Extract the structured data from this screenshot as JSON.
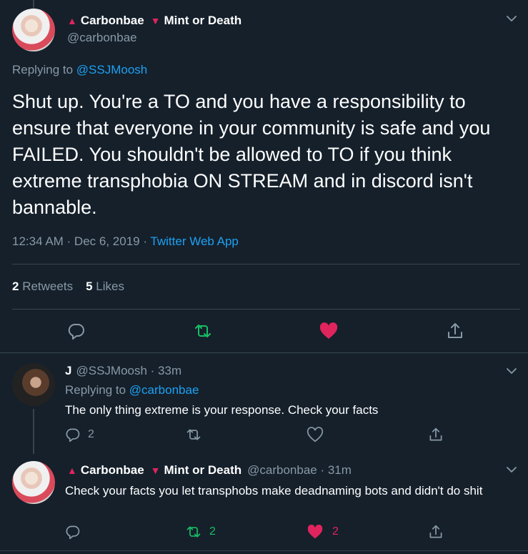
{
  "main_tweet": {
    "display_name": "Carbonbae",
    "display_name_suffix": "Mint or Death",
    "handle": "@carbonbae",
    "replying_to_label": "Replying to",
    "replying_to_handle": "@SSJMoosh",
    "text": "Shut up. You're a TO and you have a responsibility to ensure that everyone in your community is safe and you FAILED. You shouldn't be allowed to TO if you think extreme transphobia ON STREAM and in discord isn't bannable.",
    "time": "12:34 AM · Dec 6, 2019 ·",
    "source": "Twitter Web App",
    "retweets_count": "2",
    "retweets_label": "Retweets",
    "likes_count": "5",
    "likes_label": "Likes"
  },
  "replies": [
    {
      "display_name": "J",
      "handle_time": "@SSJMoosh · 33m",
      "replying_to_label": "Replying to",
      "replying_to_handle": "@carbonbae",
      "text": "The only thing extreme is your response. Check your facts",
      "reply_count": "2",
      "retweet_count": "",
      "like_count": ""
    },
    {
      "display_name": "Carbonbae",
      "display_name_suffix": "Mint or Death",
      "handle_time": "@carbonbae · 31m",
      "text": "Check your facts you let transphobs make deadnaming bots and didn't do shit",
      "reply_count": "",
      "retweet_count": "2",
      "like_count": "2"
    }
  ],
  "colors": {
    "background": "#15202b",
    "accent": "#1da1f2",
    "retweet_green": "#17bf63",
    "like_pink": "#e0245e",
    "muted": "#8899a6"
  },
  "icons": [
    "reply-icon",
    "retweet-icon",
    "like-icon",
    "share-icon",
    "chevron-down-icon",
    "triangle-up-icon",
    "triangle-down-icon"
  ]
}
